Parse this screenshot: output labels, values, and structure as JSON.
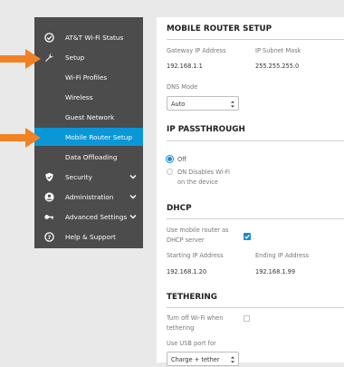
{
  "sidebar": {
    "items": [
      {
        "label": "AT&T Wi-Fi Status",
        "icon": "check-circle-icon"
      },
      {
        "label": "Setup",
        "icon": "wrench-icon"
      },
      {
        "label": "Wi-Fi Profiles"
      },
      {
        "label": "Wireless"
      },
      {
        "label": "Guest Network"
      },
      {
        "label": "Mobile Router Setup"
      },
      {
        "label": "Data Offloading"
      },
      {
        "label": "Security",
        "icon": "shield-icon"
      },
      {
        "label": "Administration",
        "icon": "person-icon"
      },
      {
        "label": "Advanced Settings",
        "icon": "key-icon"
      },
      {
        "label": "Help & Support",
        "icon": "help-icon"
      }
    ]
  },
  "mobile_router_setup": {
    "title": "MOBILE ROUTER SETUP",
    "gateway_label": "Gateway IP Address",
    "gateway_value": "192.168.1.1",
    "subnet_label": "IP Subnet Mask",
    "subnet_value": "255.255.255.0",
    "dns_label": "DNS Mode",
    "dns_value": "Auto"
  },
  "ip_passthrough": {
    "title": "IP PASSTHROUGH",
    "off_label": "Off",
    "on_label_line1": "ON Disables Wi-Fi",
    "on_label_line2": "on the device"
  },
  "dhcp": {
    "title": "DHCP",
    "use_label_line1": "Use mobile router as",
    "use_label_line2": "DHCP server",
    "use_checked": true,
    "start_label": "Starting IP Address",
    "start_value": "192.168.1.20",
    "end_label": "Ending IP Address",
    "end_value": "192.168.1.99"
  },
  "tethering": {
    "title": "TETHERING",
    "wifi_off_line1": "Turn off Wi-Fi when",
    "wifi_off_line2": "tethering",
    "usb_label": "Use USB port for",
    "usb_value": "Charge + tether"
  },
  "colors": {
    "sidebar_bg": "#4c4c4c",
    "active": "#0a97d8",
    "arrow": "#f08224",
    "accent": "#1a8ad4"
  }
}
